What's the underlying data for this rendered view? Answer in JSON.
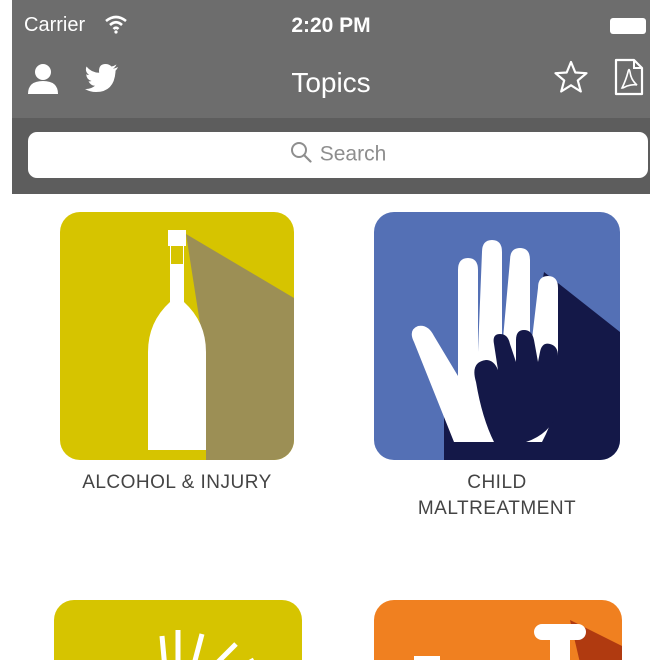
{
  "status_bar": {
    "carrier": "Carrier",
    "time": "2:20 PM",
    "icons": [
      "wifi-icon",
      "battery-icon"
    ]
  },
  "nav_bar": {
    "title": "Topics",
    "left_icons": [
      "user-icon",
      "twitter-icon"
    ],
    "right_icons": [
      "star-icon",
      "pdf-icon"
    ]
  },
  "search": {
    "placeholder": "Search",
    "icon": "search-icon"
  },
  "topics": [
    {
      "label": "ALCOHOL & INJURY",
      "icon": "bottle-icon",
      "color": "#d6c400"
    },
    {
      "label_line1": "CHILD",
      "label_line2": "MALTREATMENT",
      "icon": "hands-icon",
      "color": "#5470b5"
    },
    {
      "label": "",
      "icon": "burst-icon",
      "color": "#d6c400"
    },
    {
      "label": "",
      "icon": "hammer-icon",
      "color": "#f08020"
    }
  ],
  "colors": {
    "bar": "#6d6d6d",
    "search_band": "#5d5d5d",
    "label_text": "#444444",
    "shadow_yellow": "#9c8f55",
    "shadow_blue": "#141848"
  }
}
